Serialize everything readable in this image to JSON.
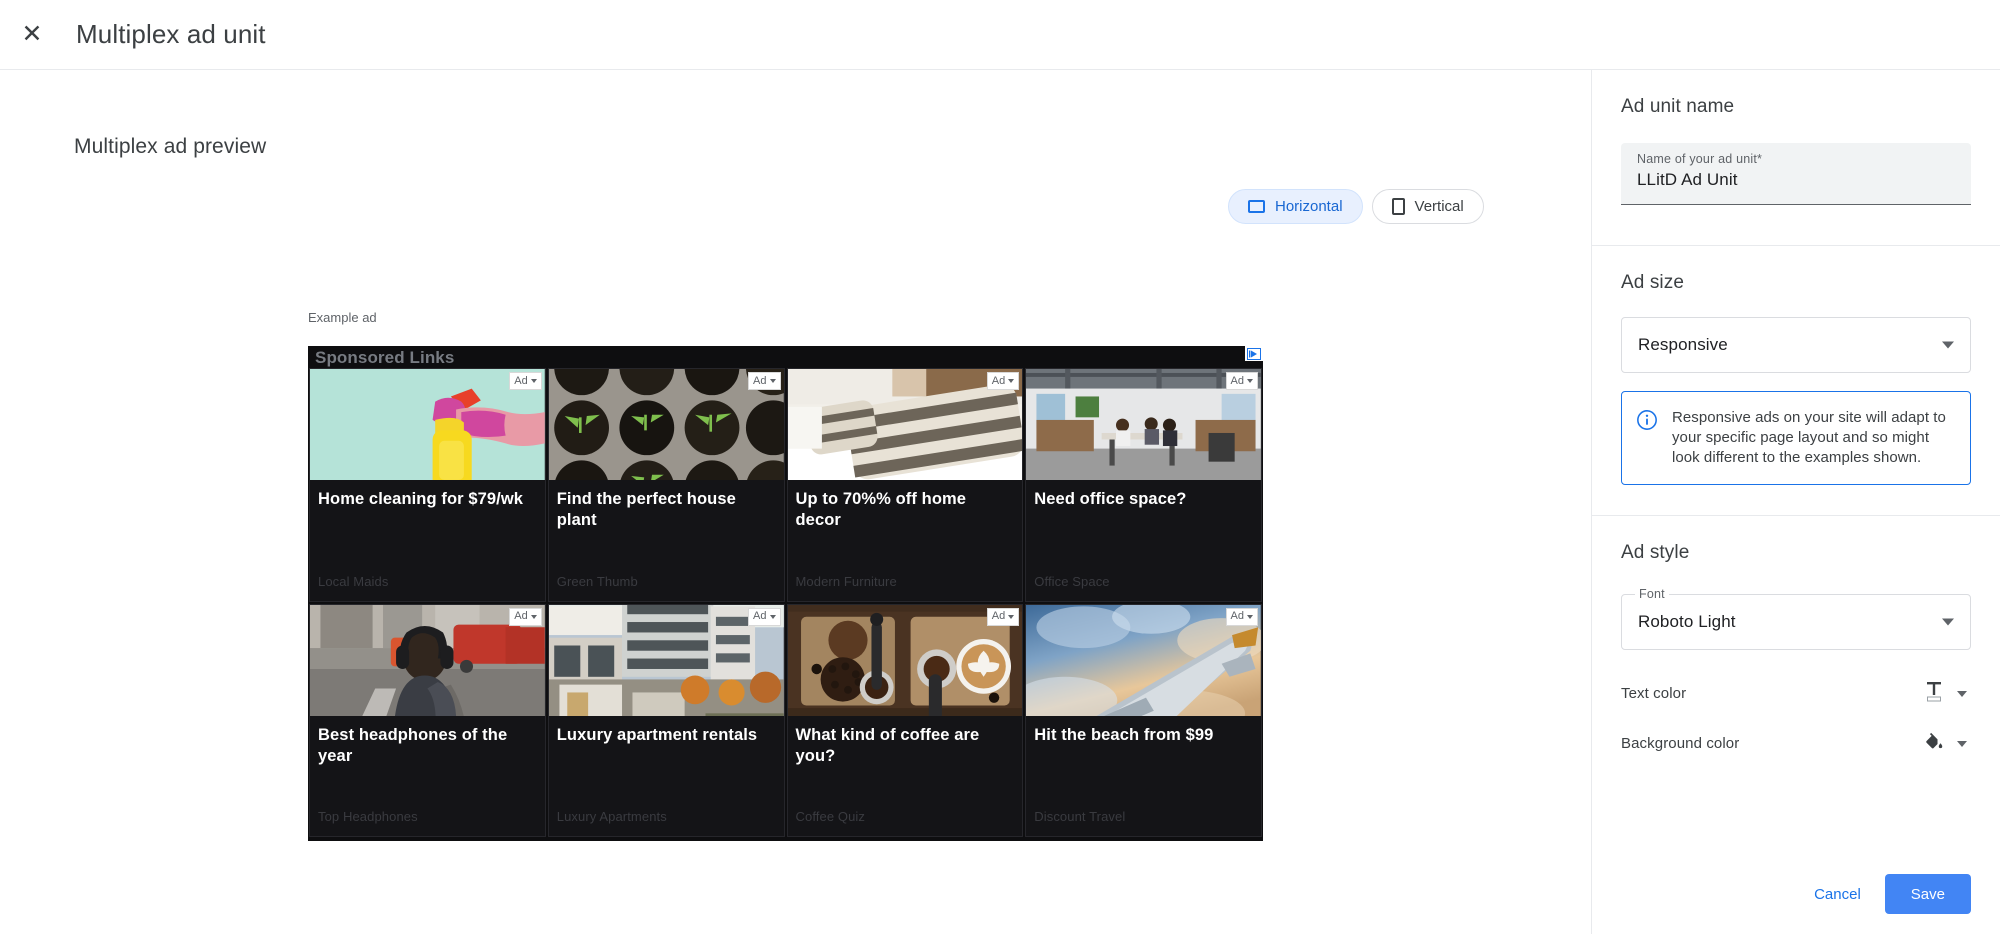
{
  "window": {
    "title": "Multiplex ad unit",
    "close_icon": "close-icon"
  },
  "preview": {
    "heading": "Multiplex ad preview",
    "example_label": "Example ad",
    "orientation_options": [
      {
        "label": "Horizontal",
        "icon": "rectangle-horizontal-icon",
        "selected": true
      },
      {
        "label": "Vertical",
        "icon": "rectangle-vertical-icon",
        "selected": false
      }
    ],
    "ad_unit": {
      "sponsored_label": "Sponsored Links",
      "adchoices_icon": "adchoices-icon",
      "badge_label": "Ad",
      "cards": [
        {
          "title": "Home cleaning for $79/wk",
          "advertiser": "Local Maids",
          "image": "spray-bottle-pink-glove"
        },
        {
          "title": "Find the perfect house plant",
          "advertiser": "Green Thumb",
          "image": "seedling-pots"
        },
        {
          "title": "Up to 70%% off home decor",
          "advertiser": "Modern Furniture",
          "image": "striped-pillows-bed"
        },
        {
          "title": "Need office space?",
          "advertiser": "Office Space",
          "image": "open-plan-office"
        },
        {
          "title": "Best headphones of the year",
          "advertiser": "Top Headphones",
          "image": "person-headphones-street"
        },
        {
          "title": "Luxury apartment rentals",
          "advertiser": "Luxury Apartments",
          "image": "modern-apartment-building"
        },
        {
          "title": "What kind of coffee are you?",
          "advertiser": "Coffee Quiz",
          "image": "coffee-flatlay"
        },
        {
          "title": "Hit the beach from $99",
          "advertiser": "Discount Travel",
          "image": "airplane-wing-clouds"
        }
      ]
    }
  },
  "sidebar": {
    "ad_unit_name": {
      "section_title": "Ad unit name",
      "field_label": "Name of your ad unit*",
      "field_value": "LLitD Ad Unit"
    },
    "ad_size": {
      "section_title": "Ad size",
      "select_value": "Responsive",
      "info_icon": "info-icon",
      "info_text": "Responsive ads on your site will adapt to your specific page layout and so might look different to the examples shown."
    },
    "ad_style": {
      "section_title": "Ad style",
      "font_label": "Font",
      "font_value": "Roboto Light",
      "text_color_label": "Text color",
      "text_color_icon": "text-color-icon",
      "background_color_label": "Background color",
      "background_color_icon": "fill-bucket-icon"
    },
    "footer": {
      "cancel_label": "Cancel",
      "save_label": "Save"
    }
  },
  "colors": {
    "accent": "#1a73e8",
    "save_button": "#4285f4",
    "chip_active_bg": "#e8f0fe",
    "ad_background": "#0e0e10",
    "ad_card_background": "#141417",
    "ad_title_text": "#ffffff",
    "ad_advertiser_text": "#3a3b40"
  }
}
